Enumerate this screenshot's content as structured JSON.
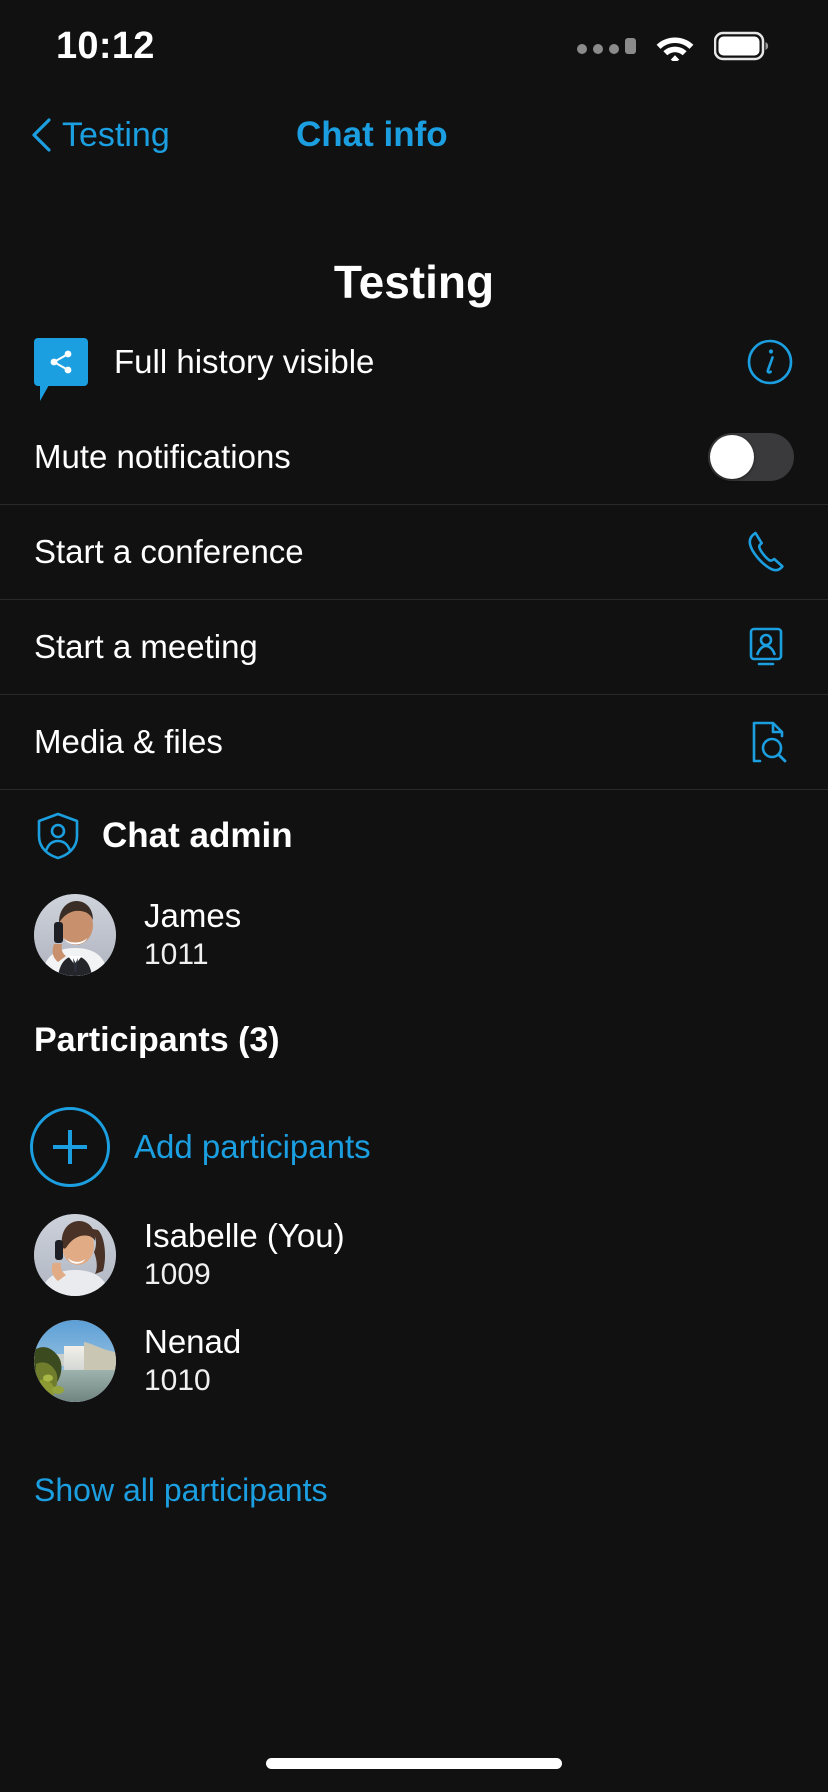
{
  "status_bar": {
    "time": "10:12",
    "signal_icon": "cellular-signal-dots-icon",
    "wifi_icon": "wifi-icon",
    "battery_icon": "battery-full-icon"
  },
  "nav": {
    "back_label": "Testing",
    "back_icon": "chevron-left-icon",
    "title": "Chat info"
  },
  "page_title": "Testing",
  "history": {
    "label": "Full history visible",
    "bubble_icon": "share-bubble-icon",
    "info_icon": "info-circle-icon"
  },
  "mute": {
    "label": "Mute notifications",
    "state": "off"
  },
  "actions": [
    {
      "label": "Start a conference",
      "icon": "phone-handset-icon"
    },
    {
      "label": "Start a meeting",
      "icon": "person-on-screen-icon"
    },
    {
      "label": "Media & files",
      "icon": "document-search-icon"
    }
  ],
  "chat_admin": {
    "title": "Chat admin",
    "icon": "shield-person-icon",
    "person": {
      "name": "James",
      "extension": "1011",
      "avatar": "man-on-phone-photo"
    }
  },
  "participants": {
    "heading": "Participants (3)",
    "count": 3,
    "add_label": "Add participants",
    "add_icon": "plus-circle-icon",
    "people": [
      {
        "name": "Isabelle (You)",
        "extension": "1009",
        "avatar": "woman-on-phone-photo"
      },
      {
        "name": "Nenad",
        "extension": "1010",
        "avatar": "waterfall-landscape-photo"
      }
    ],
    "show_all_label": "Show all participants"
  },
  "colors": {
    "accent": "#1b9fe0",
    "background": "#111111",
    "separator": "#2a2a2a",
    "text": "#ffffff"
  }
}
